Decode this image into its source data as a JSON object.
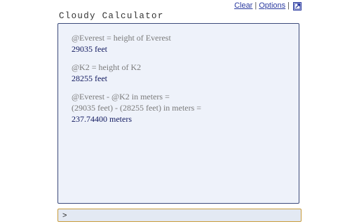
{
  "app": {
    "title": "Cloudy Calculator"
  },
  "top_links": {
    "clear_label": "Clear",
    "options_label": "Options",
    "separator": "|",
    "popout_icon": "popout-icon"
  },
  "output": {
    "entries": [
      {
        "lines": [
          "@Everest = height of Everest"
        ],
        "result": "29035 feet"
      },
      {
        "lines": [
          "@K2 = height of K2"
        ],
        "result": "28255 feet"
      },
      {
        "lines": [
          "@Everest - @K2 in meters =",
          "(29035 feet) - (28255 feet) in meters ="
        ],
        "result": "237.74400 meters"
      }
    ]
  },
  "input": {
    "prompt": ">",
    "value": ""
  },
  "colors": {
    "panel_background": "#eef2fa",
    "panel_border": "#3b4a7a",
    "input_border": "#c79a3a",
    "result_text": "#121a60",
    "expression_text": "#7a7a7a",
    "link": "#2a3aa0"
  }
}
